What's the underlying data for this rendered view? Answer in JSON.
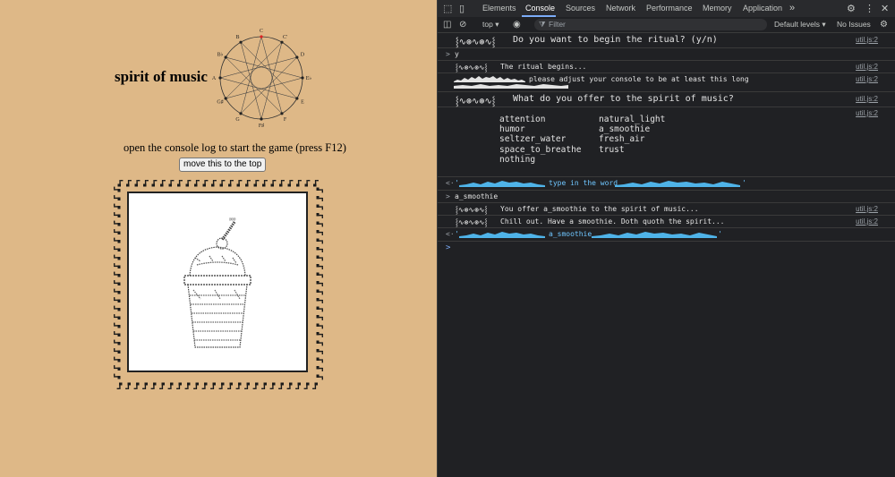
{
  "page": {
    "title": "spirit of music",
    "instruction": "open the console log to start the game (press F12)",
    "move_button": "move this to the top",
    "circle_notes": [
      "C",
      "C#",
      "D",
      "D#",
      "E",
      "F",
      "F#",
      "G",
      "G#",
      "A",
      "A#",
      "B"
    ],
    "circle_labels": [
      "C",
      "C'",
      "D",
      "E♭",
      "E",
      "F",
      "F♯",
      "G",
      "G♯",
      "A",
      "B♭",
      "B"
    ]
  },
  "devtools": {
    "tabs": [
      "Elements",
      "Console",
      "Sources",
      "Network",
      "Performance",
      "Memory",
      "Application"
    ],
    "active_tab": "Console",
    "more_tabs": "»",
    "context": "top",
    "filter_placeholder": "Filter",
    "levels": "Default levels",
    "issues": "No Issues",
    "messages": [
      {
        "kind": "log",
        "text": "Do you want to begin the ritual? (y/n)",
        "source": "util.js:2"
      },
      {
        "kind": "input",
        "text": "y"
      },
      {
        "kind": "log",
        "text": "The ritual begins...",
        "source": "util.js:2"
      },
      {
        "kind": "log",
        "text": "please adjust your console to be at least this long",
        "source": "util.js:2"
      },
      {
        "kind": "log",
        "text": "What do you offer to the spirit of music?",
        "source": "util.js:2"
      },
      {
        "kind": "log",
        "text": "",
        "source": "util.js:2"
      },
      {
        "kind": "result",
        "text": "type in the word"
      },
      {
        "kind": "input",
        "text": "a_smoothie"
      },
      {
        "kind": "log",
        "text": "You offer a_smoothie to the spirit of music...",
        "source": "util.js:2"
      },
      {
        "kind": "log",
        "text": "Chill out. Have a smoothie. Doth quoth the spirit...",
        "source": "util.js:2"
      },
      {
        "kind": "result",
        "text": "a_smoothie"
      }
    ],
    "options_col1": [
      "attention",
      "humor",
      "seltzer_water",
      "space_to_breathe",
      "nothing"
    ],
    "options_col2": [
      "natural_light",
      "a_smoothie",
      "fresh_air",
      "trust"
    ],
    "prompt_symbol": ">",
    "result_symbol": "<·",
    "ornament": "⸾∿⊛∿⊛∿⸾",
    "quote": "'"
  },
  "colors": {
    "page_bg": "#deb887",
    "console_bg": "#202124",
    "accent": "#7cacf8",
    "cyan": "#6fc6ff"
  }
}
